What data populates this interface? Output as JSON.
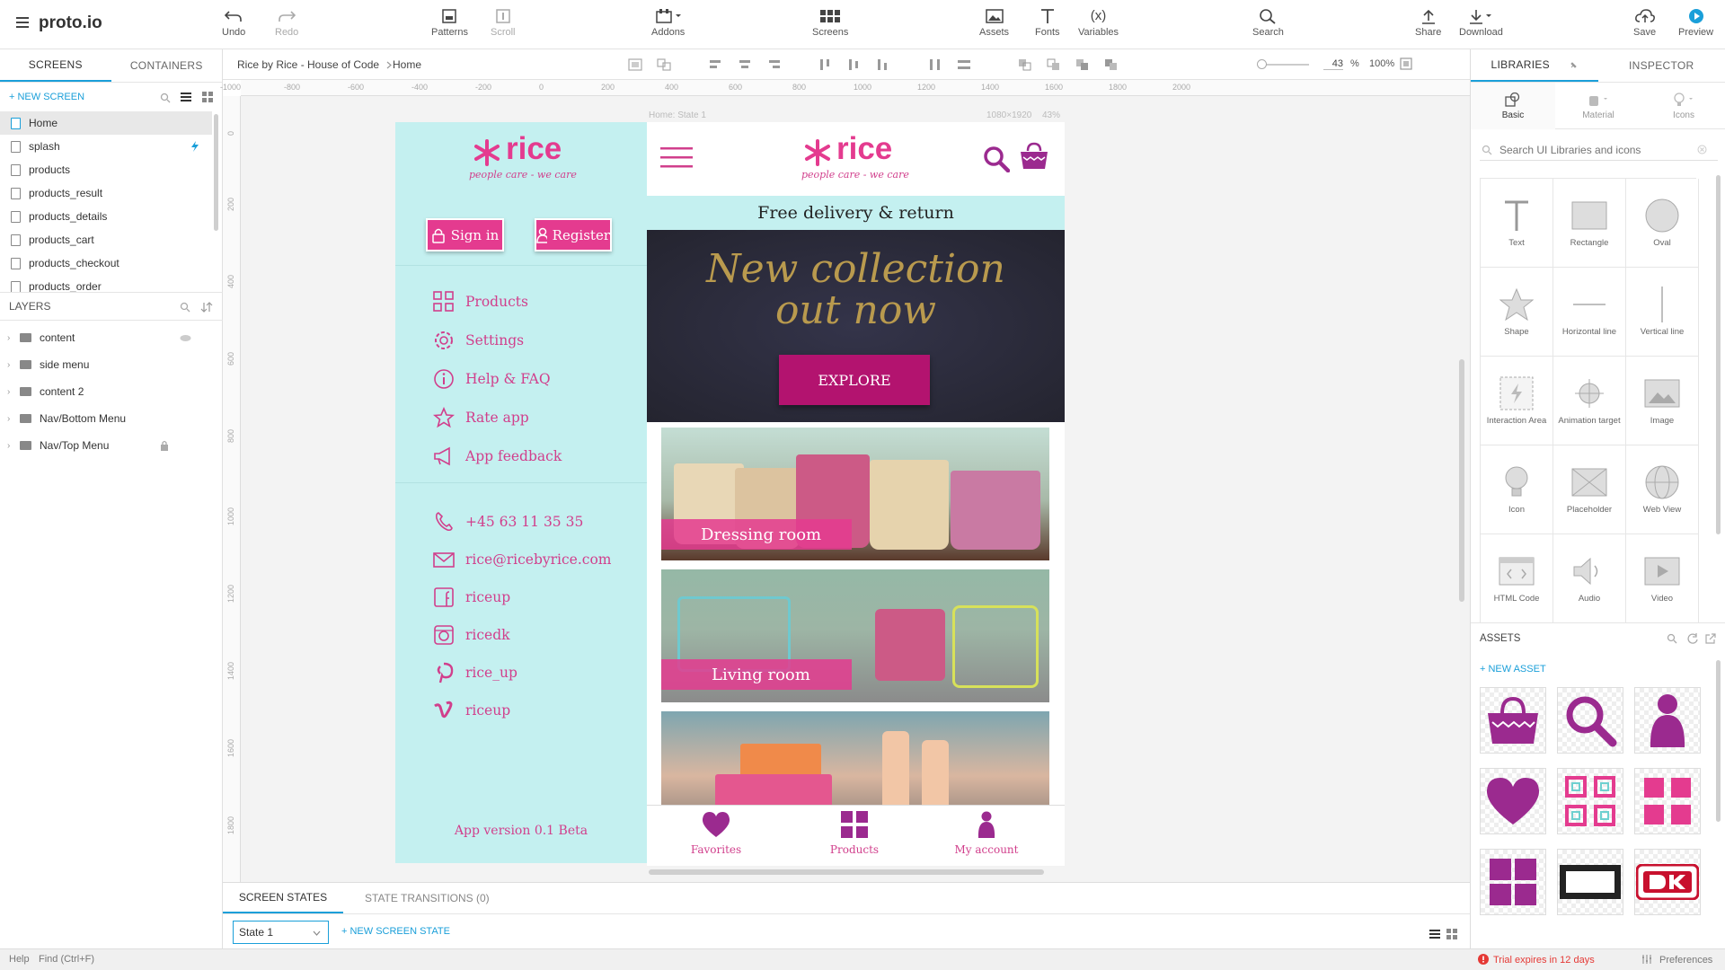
{
  "app": {
    "logo": "proto.io"
  },
  "toolbar": {
    "undo": "Undo",
    "redo": "Redo",
    "patterns": "Patterns",
    "scroll": "Scroll",
    "addons": "Addons",
    "screens": "Screens",
    "assets": "Assets",
    "fonts": "Fonts",
    "variables": "Variables",
    "variables_glyph": "(x)",
    "search": "Search",
    "share": "Share",
    "download": "Download",
    "save": "Save",
    "preview": "Preview"
  },
  "left": {
    "tabs": [
      "SCREENS",
      "CONTAINERS"
    ],
    "new_screen": "+  NEW SCREEN",
    "screens": [
      "Home",
      "splash",
      "products",
      "products_result",
      "products_details",
      "products_cart",
      "products_checkout",
      "products_order"
    ],
    "layers_title": "LAYERS",
    "layers": [
      "content",
      "side menu",
      "content 2",
      "Nav/Bottom Menu",
      "Nav/Top Menu"
    ]
  },
  "breadcrumb": {
    "project": "Rice by Rice - House of Code",
    "screen": "Home"
  },
  "zoom": {
    "value": "43",
    "unit": "%",
    "full": "100%"
  },
  "rulers": {
    "h": [
      "-1000",
      "-800",
      "-600",
      "-400",
      "-200",
      "0",
      "200",
      "400",
      "600",
      "800",
      "1000",
      "1200",
      "1400",
      "1600",
      "1800",
      "2000"
    ],
    "v": [
      "0",
      "200",
      "400",
      "600",
      "800",
      "1000",
      "1200",
      "1400",
      "1600",
      "1800"
    ]
  },
  "canvas": {
    "state_label": "Home: State 1",
    "size_label": "1080×1920",
    "zoom_label": "43%"
  },
  "sidemenu": {
    "logo": "rice",
    "tagline": "people care - we care",
    "sign_in": "Sign in",
    "register": "Register",
    "items": [
      "Products",
      "Settings",
      "Help & FAQ",
      "Rate app",
      "App feedback"
    ],
    "contacts": [
      "+45 63 11 35 35",
      "rice@ricebyrice.com",
      "riceup",
      "ricedk",
      "rice_up",
      "riceup"
    ],
    "version": "App version 0.1 Beta"
  },
  "phone": {
    "logo": "rice",
    "tagline": "people care - we care",
    "banner": "Free delivery & return",
    "hero_line1": "New collection",
    "hero_line2": "out now",
    "explore": "EXPLORE",
    "categories": [
      "Dressing room",
      "Living room"
    ],
    "nav": [
      "Favorites",
      "Products",
      "My account"
    ]
  },
  "bottom": {
    "tabs": [
      "SCREEN STATES",
      "STATE TRANSITIONS (0)"
    ],
    "state_value": "State 1",
    "new_state": "+  NEW SCREEN STATE"
  },
  "status": {
    "help": "Help",
    "find": "Find (Ctrl+F)",
    "trial": "Trial expires in 12 days",
    "preferences": "Preferences"
  },
  "right": {
    "tabs": [
      "LIBRARIES",
      "INSPECTOR"
    ],
    "lib_tabs": [
      "Basic",
      "Material",
      "Icons"
    ],
    "search_placeholder": "Search UI Libraries and icons",
    "components": [
      "Text",
      "Rectangle",
      "Oval",
      "Shape",
      "Horizontal line",
      "Vertical line",
      "Interaction Area",
      "Animation target",
      "Image",
      "Icon",
      "Placeholder",
      "Web View",
      "HTML Code",
      "Audio",
      "Video"
    ],
    "assets_title": "ASSETS",
    "new_asset": "+  NEW ASSET"
  },
  "colors": {
    "accent": "#1a9fd9",
    "brand_pink": "#e43b8f",
    "brand_purple": "#9b2a8f",
    "menu_bg": "#c4f0f0",
    "hero_bg": "#2a2a38"
  }
}
